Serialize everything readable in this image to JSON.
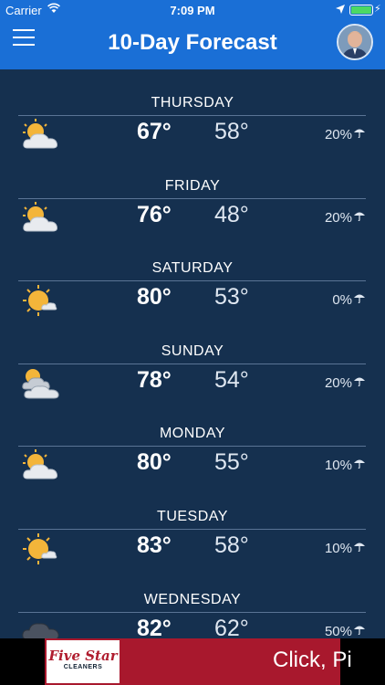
{
  "status": {
    "carrier": "Carrier",
    "time": "7:09 PM",
    "battery_level": 1.0
  },
  "header": {
    "title": "10-Day Forecast"
  },
  "forecast": [
    {
      "day": "THURSDAY",
      "high": "67°",
      "low": "58°",
      "precip": "20%",
      "icon": "partly-cloudy-icon"
    },
    {
      "day": "FRIDAY",
      "high": "76°",
      "low": "48°",
      "precip": "20%",
      "icon": "partly-cloudy-icon"
    },
    {
      "day": "SATURDAY",
      "high": "80°",
      "low": "53°",
      "precip": "0%",
      "icon": "mostly-sunny-icon"
    },
    {
      "day": "SUNDAY",
      "high": "78°",
      "low": "54°",
      "precip": "20%",
      "icon": "mostly-cloudy-icon"
    },
    {
      "day": "MONDAY",
      "high": "80°",
      "low": "55°",
      "precip": "10%",
      "icon": "partly-cloudy-icon"
    },
    {
      "day": "TUESDAY",
      "high": "83°",
      "low": "58°",
      "precip": "10%",
      "icon": "mostly-sunny-icon"
    },
    {
      "day": "WEDNESDAY",
      "high": "82°",
      "low": "62°",
      "precip": "50%",
      "icon": "storm-icon"
    }
  ],
  "ad": {
    "logo_line1": "Five Star",
    "logo_line2": "CLEANERS",
    "cta": "Click, Pi"
  },
  "colors": {
    "header": "#1a6fd6",
    "background": "#15304f",
    "ad_red": "#a8182d"
  }
}
